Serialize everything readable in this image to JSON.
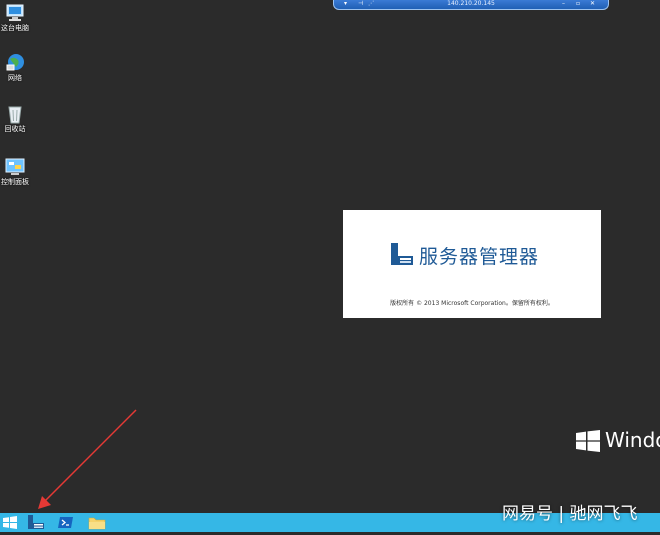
{
  "desktop": {
    "icons": [
      {
        "label": "这台电脑",
        "icon": "computer-icon"
      },
      {
        "label": "网络",
        "icon": "network-icon"
      },
      {
        "label": "回收站",
        "icon": "recycle-bin-icon"
      },
      {
        "label": "控制面板",
        "icon": "control-panel-icon"
      }
    ]
  },
  "remote_bar": {
    "ip": "140.210.20.145"
  },
  "splash": {
    "title": "服务器管理器",
    "copyright": "版权所有 © 2013 Microsoft Corporation。保留所有权利。"
  },
  "os_watermark": "Windo",
  "taskbar": {
    "items": [
      "start-button",
      "server-manager-button",
      "powershell-button",
      "file-explorer-button"
    ],
    "color": "#35b7e6"
  },
  "image_watermark": "网易号 | 驰网飞飞",
  "colors": {
    "desktop_bg": "#2b2b2b",
    "accent": "#1f5a96",
    "arrow": "#e53935"
  }
}
